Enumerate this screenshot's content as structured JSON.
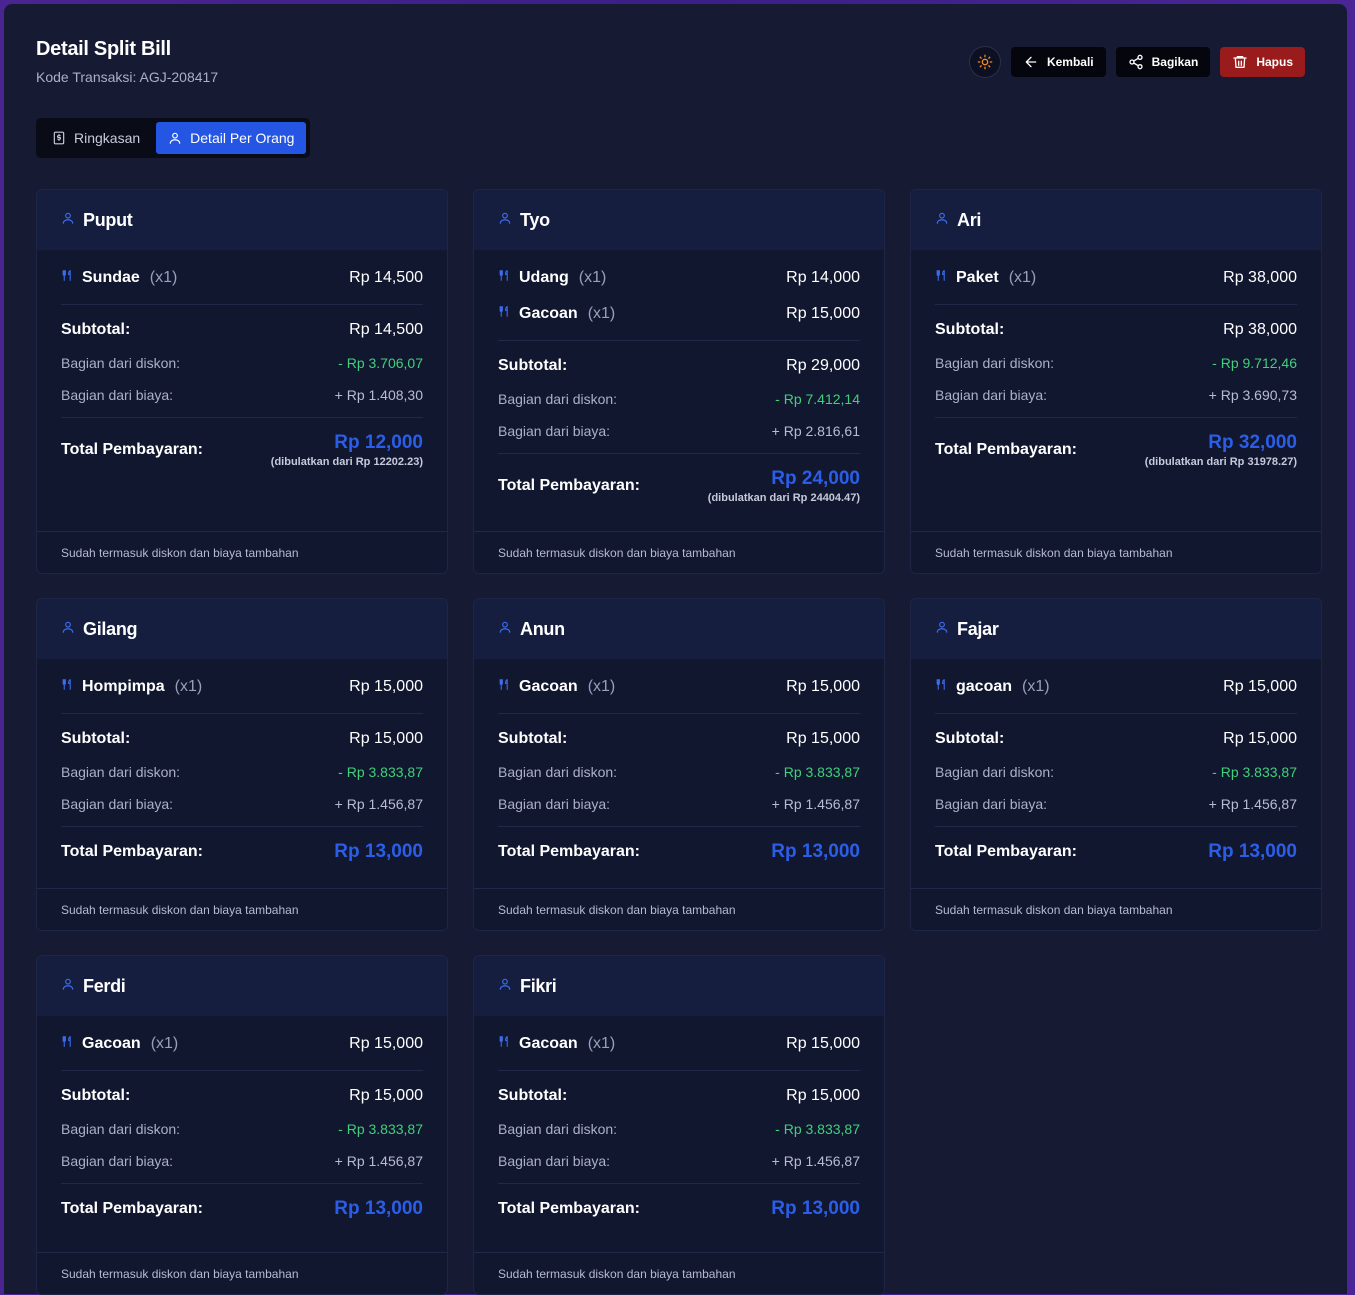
{
  "header": {
    "title": "Detail Split Bill",
    "subtitle": "Kode Transaksi: AGJ-208417"
  },
  "actions": {
    "theme_icon": "sun-icon",
    "back_label": "Kembali",
    "share_label": "Bagikan",
    "delete_label": "Hapus",
    "delete_color": "#9a1b1b"
  },
  "tabs": {
    "summary_label": "Ringkasan",
    "per_person_label": "Detail Per Orang",
    "active": "per_person",
    "active_color": "#2555e3"
  },
  "labels": {
    "subtotal": "Subtotal:",
    "discount_share": "Bagian dari diskon:",
    "fee_share": "Bagian dari biaya:",
    "total": "Total Pembayaran:",
    "footer": "Sudah termasuk diskon dan biaya tambahan"
  },
  "colors": {
    "accent": "#2b5ee8",
    "discount": "#3fd07a"
  },
  "people": [
    {
      "name": "Puput",
      "items": [
        {
          "name": "Sundae",
          "qty": "(x1)",
          "price": "Rp 14,500"
        }
      ],
      "subtotal": "Rp 14,500",
      "discount": "- Rp 3.706,07",
      "fee": "+ Rp 1.408,30",
      "total": "Rp 12,000",
      "note": "(dibulatkan dari Rp 12202.23)"
    },
    {
      "name": "Tyo",
      "items": [
        {
          "name": "Udang",
          "qty": "(x1)",
          "price": "Rp 14,000"
        },
        {
          "name": "Gacoan",
          "qty": "(x1)",
          "price": "Rp 15,000"
        }
      ],
      "subtotal": "Rp 29,000",
      "discount": "- Rp 7.412,14",
      "fee": "+ Rp 2.816,61",
      "total": "Rp 24,000",
      "note": "(dibulatkan dari Rp 24404.47)"
    },
    {
      "name": "Ari",
      "items": [
        {
          "name": "Paket",
          "qty": "(x1)",
          "price": "Rp 38,000"
        }
      ],
      "subtotal": "Rp 38,000",
      "discount": "- Rp 9.712,46",
      "fee": "+ Rp 3.690,73",
      "total": "Rp 32,000",
      "note": "(dibulatkan dari Rp 31978.27)"
    },
    {
      "name": "Gilang",
      "items": [
        {
          "name": "Hompimpa",
          "qty": "(x1)",
          "price": "Rp 15,000"
        }
      ],
      "subtotal": "Rp 15,000",
      "discount": "- Rp 3.833,87",
      "fee": "+ Rp 1.456,87",
      "total": "Rp 13,000",
      "note": ""
    },
    {
      "name": "Anun",
      "items": [
        {
          "name": "Gacoan",
          "qty": "(x1)",
          "price": "Rp 15,000"
        }
      ],
      "subtotal": "Rp 15,000",
      "discount": "- Rp 3.833,87",
      "fee": "+ Rp 1.456,87",
      "total": "Rp 13,000",
      "note": ""
    },
    {
      "name": "Fajar",
      "items": [
        {
          "name": "gacoan",
          "qty": "(x1)",
          "price": "Rp 15,000"
        }
      ],
      "subtotal": "Rp 15,000",
      "discount": "- Rp 3.833,87",
      "fee": "+ Rp 1.456,87",
      "total": "Rp 13,000",
      "note": ""
    },
    {
      "name": "Ferdi",
      "items": [
        {
          "name": "Gacoan",
          "qty": "(x1)",
          "price": "Rp 15,000"
        }
      ],
      "subtotal": "Rp 15,000",
      "discount": "- Rp 3.833,87",
      "fee": "+ Rp 1.456,87",
      "total": "Rp 13,000",
      "note": ""
    },
    {
      "name": "Fikri",
      "items": [
        {
          "name": "Gacoan",
          "qty": "(x1)",
          "price": "Rp 15,000"
        }
      ],
      "subtotal": "Rp 15,000",
      "discount": "- Rp 3.833,87",
      "fee": "+ Rp 1.456,87",
      "total": "Rp 13,000",
      "note": ""
    }
  ]
}
